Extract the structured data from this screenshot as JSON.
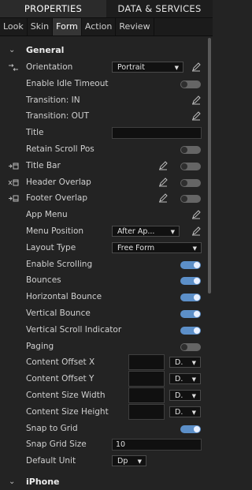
{
  "top_tabs": [
    "PROPERTIES",
    "DATA & SERVICES"
  ],
  "sub_tabs": [
    "Look",
    "Skin",
    "Form",
    "Action",
    "Review"
  ],
  "sections": {
    "general": "General",
    "iphone": "iPhone"
  },
  "fields": {
    "orientation": {
      "label": "Orientation",
      "value": "Portrait"
    },
    "enable_idle_timeout": "Enable Idle Timeout",
    "transition_in": "Transition: IN",
    "transition_out": "Transition: OUT",
    "title": "Title",
    "retain_scroll_pos": "Retain Scroll Pos",
    "title_bar": "Title Bar",
    "header_overlap": "Header Overlap",
    "footer_overlap": "Footer Overlap",
    "app_menu": "App Menu",
    "menu_position": {
      "label": "Menu Position",
      "value": "After Ap..."
    },
    "layout_type": {
      "label": "Layout Type",
      "value": "Free Form"
    },
    "enable_scrolling": "Enable Scrolling",
    "bounces": "Bounces",
    "horizontal_bounce": "Horizontal Bounce",
    "vertical_bounce": "Vertical Bounce",
    "vertical_scroll_indicator": "Vertical Scroll Indicator",
    "paging": "Paging",
    "content_offset_x": {
      "label": "Content Offset X",
      "unit": "D."
    },
    "content_offset_y": {
      "label": "Content Offset Y",
      "unit": "D."
    },
    "content_size_width": {
      "label": "Content Size Width",
      "unit": "D."
    },
    "content_size_height": {
      "label": "Content Size Height",
      "unit": "D."
    },
    "snap_to_grid": "Snap to Grid",
    "snap_grid_size": {
      "label": "Snap Grid Size",
      "value": "10"
    },
    "default_unit": {
      "label": "Default Unit",
      "value": "Dp"
    }
  },
  "toggles": {
    "enable_idle_timeout": false,
    "retain_scroll_pos": false,
    "title_bar": false,
    "header_overlap": false,
    "footer_overlap": false,
    "enable_scrolling": true,
    "bounces": true,
    "horizontal_bounce": true,
    "vertical_bounce": true,
    "vertical_scroll_indicator": true,
    "paging": false,
    "snap_to_grid": true
  },
  "icons": {
    "section_chevron": "chevron-down-icon",
    "pencil": "pencil-icon",
    "lead_orientation": "orientation-icon",
    "lead_title_bar": "title-bar-icon",
    "lead_header_overlap": "header-overlap-icon",
    "lead_footer_overlap": "footer-overlap-icon"
  },
  "colors": {
    "toggle_on": "#5c8fc8",
    "toggle_off": "#656565",
    "background": "#232323"
  }
}
